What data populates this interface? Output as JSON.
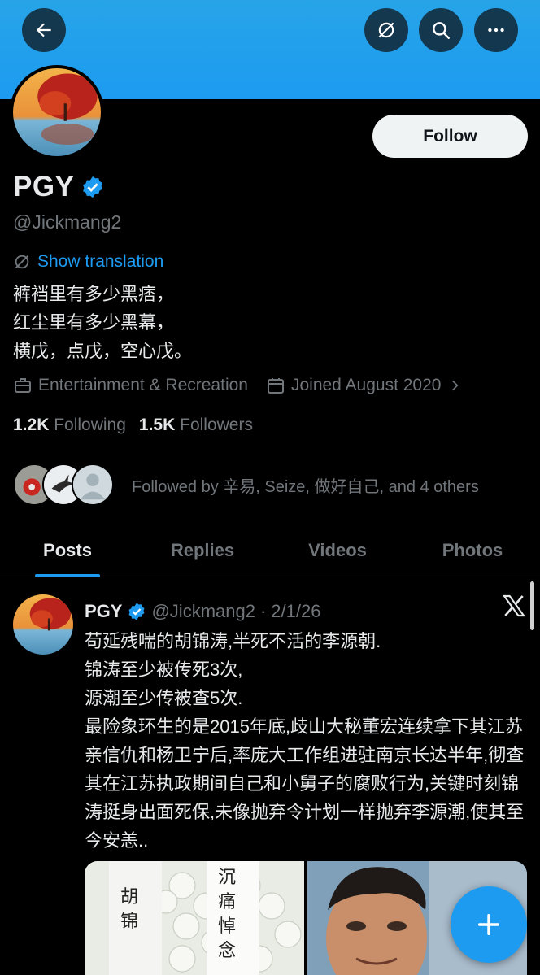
{
  "header": {
    "back_icon": "arrow-left-icon",
    "translate_icon": "translate-off-icon",
    "search_icon": "search-icon",
    "more_icon": "ellipsis-icon"
  },
  "profile": {
    "display_name": "PGY",
    "handle": "@Jickmang2",
    "verified": true,
    "follow_label": "Follow",
    "show_translation": "Show translation",
    "bio_lines": [
      "裤裆里有多少黑痞，",
      "红尘里有多少黑幕，",
      "横戊，点戊，空心戊。"
    ],
    "category": "Entertainment & Recreation",
    "joined": "Joined August 2020",
    "following_count": "1.2K",
    "following_label": "Following",
    "followers_count": "1.5K",
    "followers_label": "Followers",
    "followed_by": "Followed by 辛易, Seize, 做好自己, and 4 others"
  },
  "tabs": [
    {
      "label": "Posts",
      "active": true
    },
    {
      "label": "Replies",
      "active": false
    },
    {
      "label": "Videos",
      "active": false
    },
    {
      "label": "Photos",
      "active": false
    }
  ],
  "post": {
    "name": "PGY",
    "handle": "@Jickmang2",
    "separator": "·",
    "date": "2/1/26",
    "text": "苟延残喘的胡锦涛,半死不活的李源朝.\n锦涛至少被传死3次,\n源潮至少传被查5次.\n最险象环生的是2015年底,歧山大秘董宏连续拿下其江苏亲信仇和杨卫宁后,率庞大工作组进驻南京长达半年,彻查其在江苏执政期间自己和小舅子的腐败行为,关键时刻锦涛挺身出面死保,未像抛弃令计划一样抛弃李源潮,使其至今安恙..",
    "media_text_left": "胡\n锦",
    "media_text_mid": "沉\n痛\n悼\n念"
  },
  "fab_icon": "plus-icon",
  "colors": {
    "accent": "#1d9bf0",
    "background": "#000000",
    "muted": "#71767b"
  }
}
